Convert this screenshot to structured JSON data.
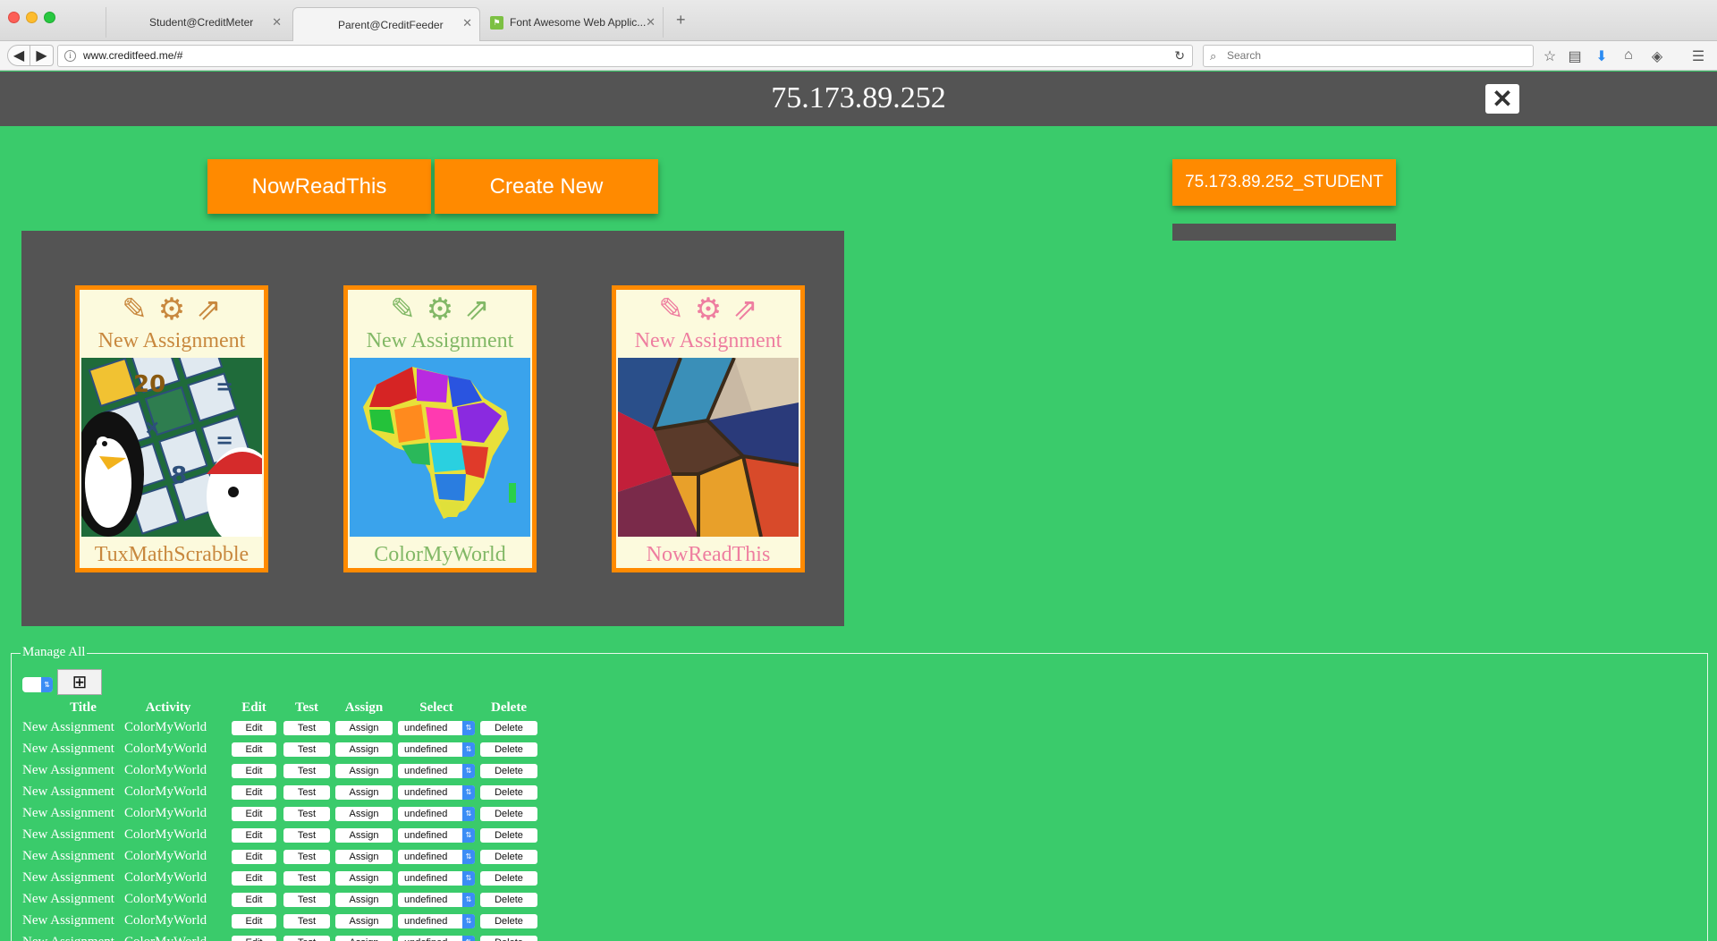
{
  "browser": {
    "tabs": [
      {
        "title": "Student@CreditMeter"
      },
      {
        "title": "Parent@CreditFeeder"
      },
      {
        "title": "Font Awesome Web Applic..."
      }
    ],
    "url": "www.creditfeed.me/#",
    "search_placeholder": "Search"
  },
  "header": {
    "title": "75.173.89.252"
  },
  "actions": {
    "nowreadthis_label": "NowReadThis",
    "create_new_label": "Create New",
    "student_label": "75.173.89.252_STUDENT"
  },
  "cards": [
    {
      "title": "New Assignment",
      "activity": "TuxMathScrabble",
      "color": "#c8883e"
    },
    {
      "title": "New Assignment",
      "activity": "ColorMyWorld",
      "color": "#82b866"
    },
    {
      "title": "New Assignment",
      "activity": "NowReadThis",
      "color": "#ee7ea0"
    }
  ],
  "manage": {
    "legend": "Manage All",
    "columns": [
      "Title",
      "Activity",
      "Edit",
      "Test",
      "Assign",
      "Select",
      "Delete"
    ],
    "rows": [
      {
        "title": "New Assignment",
        "activity": "ColorMyWorld",
        "edit": "Edit",
        "test": "Test",
        "assign": "Assign",
        "select": "undefined",
        "delete": "Delete"
      },
      {
        "title": "New Assignment",
        "activity": "ColorMyWorld",
        "edit": "Edit",
        "test": "Test",
        "assign": "Assign",
        "select": "undefined",
        "delete": "Delete"
      },
      {
        "title": "New Assignment",
        "activity": "ColorMyWorld",
        "edit": "Edit",
        "test": "Test",
        "assign": "Assign",
        "select": "undefined",
        "delete": "Delete"
      },
      {
        "title": "New Assignment",
        "activity": "ColorMyWorld",
        "edit": "Edit",
        "test": "Test",
        "assign": "Assign",
        "select": "undefined",
        "delete": "Delete"
      },
      {
        "title": "New Assignment",
        "activity": "ColorMyWorld",
        "edit": "Edit",
        "test": "Test",
        "assign": "Assign",
        "select": "undefined",
        "delete": "Delete"
      },
      {
        "title": "New Assignment",
        "activity": "ColorMyWorld",
        "edit": "Edit",
        "test": "Test",
        "assign": "Assign",
        "select": "undefined",
        "delete": "Delete"
      },
      {
        "title": "New Assignment",
        "activity": "ColorMyWorld",
        "edit": "Edit",
        "test": "Test",
        "assign": "Assign",
        "select": "undefined",
        "delete": "Delete"
      },
      {
        "title": "New Assignment",
        "activity": "ColorMyWorld",
        "edit": "Edit",
        "test": "Test",
        "assign": "Assign",
        "select": "undefined",
        "delete": "Delete"
      },
      {
        "title": "New Assignment",
        "activity": "ColorMyWorld",
        "edit": "Edit",
        "test": "Test",
        "assign": "Assign",
        "select": "undefined",
        "delete": "Delete"
      },
      {
        "title": "New Assignment",
        "activity": "ColorMyWorld",
        "edit": "Edit",
        "test": "Test",
        "assign": "Assign",
        "select": "undefined",
        "delete": "Delete"
      },
      {
        "title": "New Assignment",
        "activity": "ColorMyWorld",
        "edit": "Edit",
        "test": "Test",
        "assign": "Assign",
        "select": "undefined",
        "delete": "Delete"
      }
    ]
  },
  "colors": {
    "page_bg": "#3acb6b",
    "header_bg": "#545454",
    "accent": "#ff8a00",
    "card_bg": "#fcfadd"
  }
}
